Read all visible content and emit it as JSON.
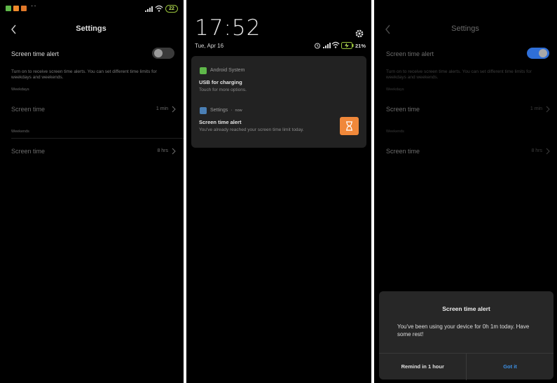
{
  "colors": {
    "background": "#000000",
    "separator_gap": "#ffffff",
    "toggle_on": "#2f6fd8",
    "toggle_off": "#3a3a3a",
    "accent_button": "#3d8fe3",
    "notification_icon_orange": "#f0883a",
    "status_green": "#9ac43c"
  },
  "panel_left": {
    "status_bar": {
      "left_icons": [
        "green-notification-icon",
        "orange-notification-icon",
        "orange-notification-icon"
      ],
      "more": "··",
      "battery": "22"
    },
    "header": {
      "title": "Settings",
      "back_icon": "chevron-left-icon"
    },
    "alert_toggle": {
      "label": "Screen time alert",
      "state": "off"
    },
    "description": "Turn on to receive screen time alerts. You can set different time limits for weekdays and weekends.",
    "weekdays": {
      "section_label": "Weekdays",
      "row_label": "Screen time",
      "value": "1 min"
    },
    "weekends": {
      "section_label": "Weekends",
      "row_label": "Screen time",
      "value": "8 hrs"
    }
  },
  "panel_middle": {
    "time": "17:52",
    "date": "Tue, Apr 16",
    "battery_percent": "21%",
    "notifications": [
      {
        "app_name": "Android System",
        "title": "USB for charging",
        "body": "Touch for more options.",
        "icon": "android-system-icon"
      },
      {
        "app_name": "Settings",
        "timestamp": "now",
        "separator": "·",
        "title": "Screen time alert",
        "body": "You've already reached your screen time limit today.",
        "icon": "settings-app-icon",
        "large_icon": "hourglass-icon"
      }
    ]
  },
  "panel_right": {
    "header": {
      "title": "Settings",
      "back_icon": "chevron-left-icon"
    },
    "alert_toggle": {
      "label": "Screen time alert",
      "state": "on"
    },
    "description": "Turn on to receive screen time alerts. You can set different time limits for weekdays and weekends.",
    "weekdays": {
      "section_label": "Weekdays",
      "row_label": "Screen time",
      "value": "1 min"
    },
    "weekends": {
      "section_label": "Weekends",
      "row_label": "Screen time",
      "value": "8 hrs"
    },
    "dialog": {
      "title": "Screen time alert",
      "message": "You've been using your device for 0h 1m today. Have some rest!",
      "secondary_button": "Remind in 1 hour",
      "primary_button": "Got it"
    }
  }
}
